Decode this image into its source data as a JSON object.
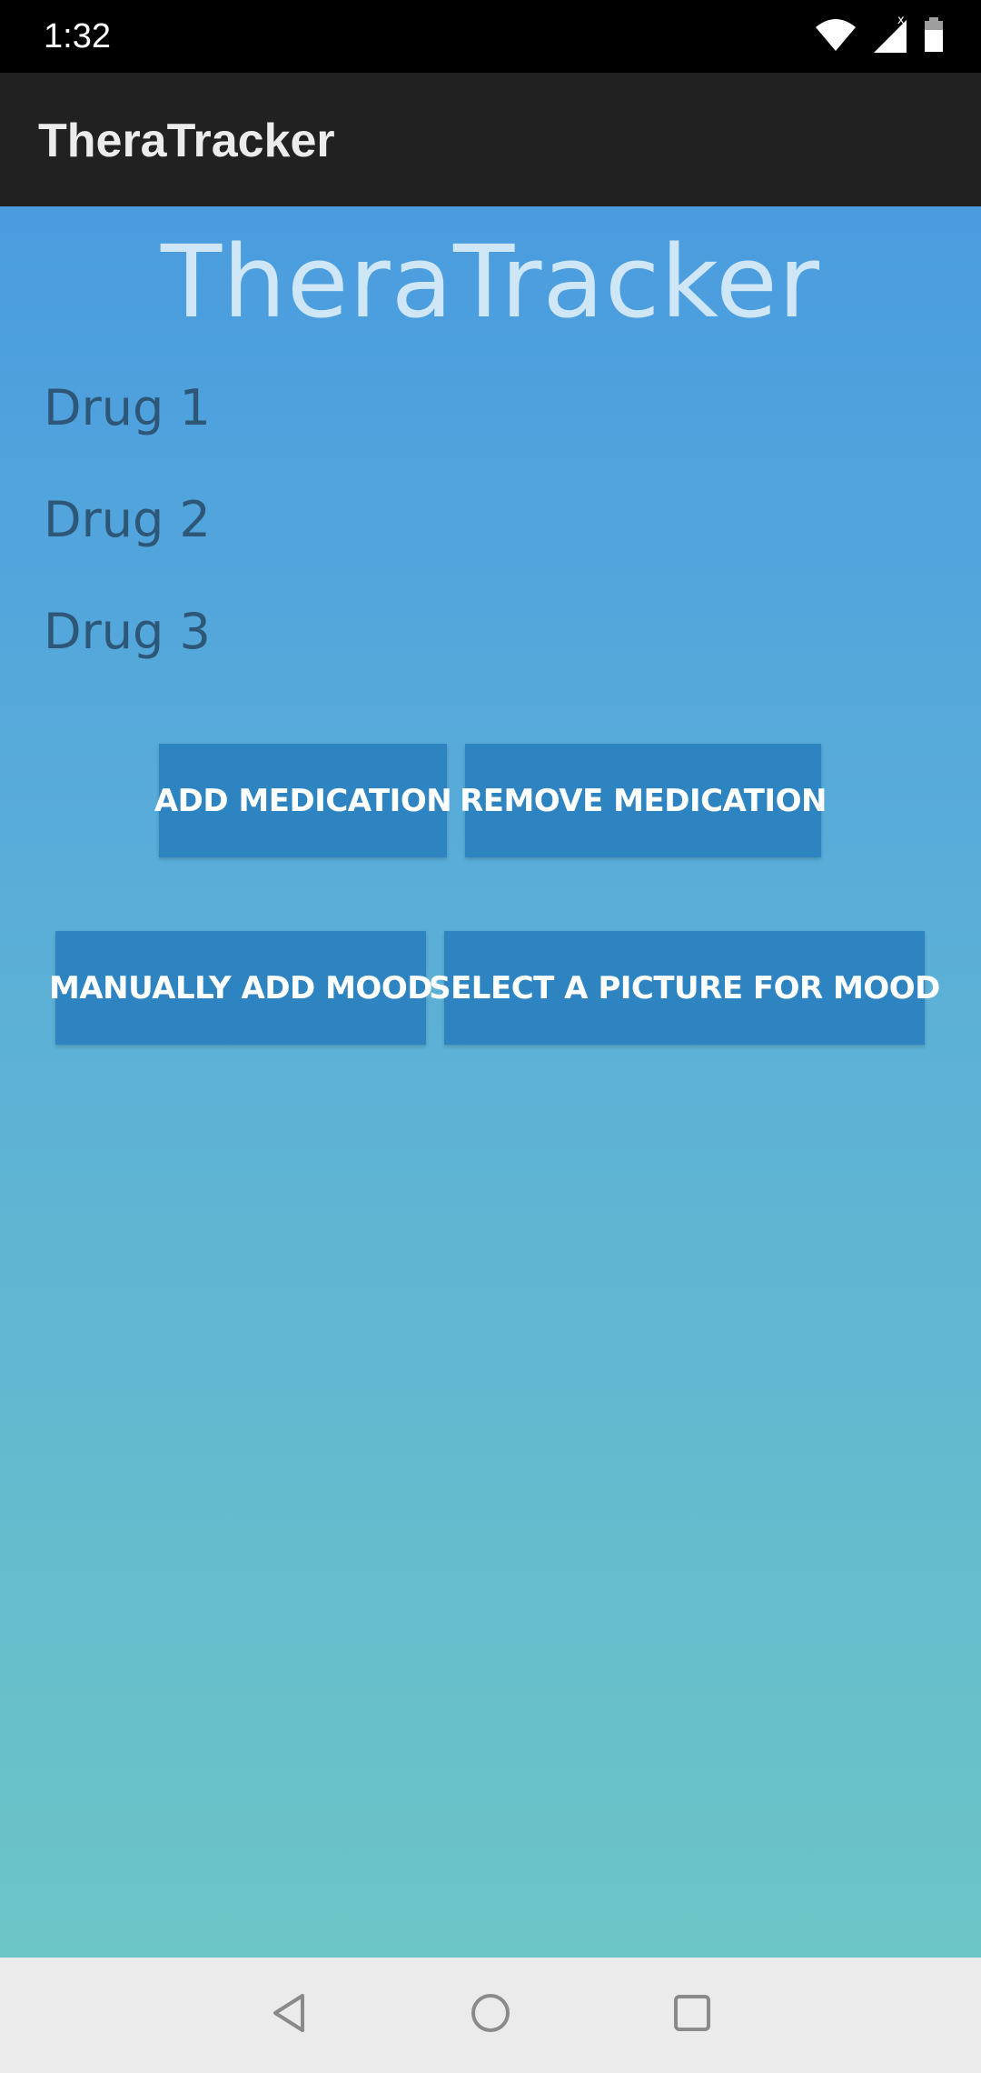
{
  "status_bar": {
    "time": "1:32",
    "icons": [
      "wifi-icon",
      "signal-icon",
      "battery-icon"
    ]
  },
  "app_bar": {
    "title": "TheraTracker"
  },
  "main": {
    "title": "TheraTracker",
    "drugs": [
      "Drug 1",
      "Drug 2",
      "Drug 3"
    ],
    "buttons": {
      "add_medication": "ADD MEDICATION",
      "remove_medication": "REMOVE MEDICATION",
      "manually_add_mood": "MANUALLY ADD MOOD",
      "select_picture_for_mood": "SELECT A PICTURE FOR MOOD"
    }
  },
  "nav_bar": {
    "icons": [
      "back-icon",
      "home-icon",
      "recents-icon"
    ]
  },
  "colors": {
    "app_bar": "#212121",
    "button": "#2e84c1",
    "gradient_top": "#4a9cdf",
    "gradient_bottom": "#6cc5c6",
    "drug_text": "#2d5677",
    "hero_text": "#cfe6f7"
  }
}
